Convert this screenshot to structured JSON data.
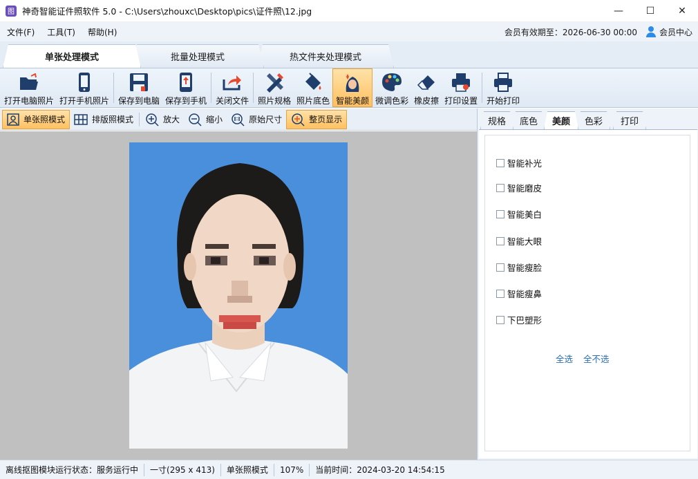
{
  "window": {
    "title": "神奇智能证件照软件 5.0 - C:\\Users\\zhouxc\\Desktop\\pics\\证件照\\12.jpg",
    "app_icon_glyph": "图",
    "minimize_glyph": "—",
    "maximize_glyph": "☐",
    "close_glyph": "✕"
  },
  "menu": {
    "file": "文件(F)",
    "tools": "工具(T)",
    "help": "帮助(H)",
    "member_validity": "会员有效期至：2026-06-30 00:00",
    "member_center": "会员中心"
  },
  "mode_tabs": [
    "单张处理模式",
    "批量处理模式",
    "热文件夹处理模式"
  ],
  "toolbar": {
    "items": [
      {
        "label": "打开电脑照片",
        "icon": "folder-open-icon"
      },
      {
        "label": "打开手机照片",
        "icon": "phone-icon"
      },
      {
        "label": "保存到电脑",
        "icon": "save-icon"
      },
      {
        "label": "保存到手机",
        "icon": "phone-upload-icon"
      },
      {
        "label": "关闭文件",
        "icon": "share-icon"
      },
      {
        "label": "照片规格",
        "icon": "pencil-ruler-icon"
      },
      {
        "label": "照片底色",
        "icon": "paint-bucket-icon"
      },
      {
        "label": "智能美颜",
        "icon": "beauty-face-icon"
      },
      {
        "label": "微调色彩",
        "icon": "palette-icon"
      },
      {
        "label": "橡皮擦",
        "icon": "eraser-icon"
      },
      {
        "label": "打印设置",
        "icon": "printer-settings-icon"
      },
      {
        "label": "开始打印",
        "icon": "printer-icon"
      }
    ],
    "active": "智能美颜"
  },
  "viewbar": {
    "single_mode": "单张照模式",
    "layout_mode": "排版照模式",
    "zoom_in": "放大",
    "zoom_out": "缩小",
    "original_size": "原始尺寸",
    "fit_page": "整页显示"
  },
  "panel": {
    "tabs": [
      "规格",
      "底色",
      "美颜",
      "色彩",
      "打印"
    ],
    "active_tab": "美颜",
    "options": [
      {
        "label": "智能补光",
        "checked": false
      },
      {
        "label": "智能磨皮",
        "checked": false
      },
      {
        "label": "智能美白",
        "checked": false
      },
      {
        "label": "智能大眼",
        "checked": false
      },
      {
        "label": "智能瘦脸",
        "checked": false
      },
      {
        "label": "智能瘦鼻",
        "checked": false
      },
      {
        "label": "下巴塑形",
        "checked": false
      }
    ],
    "select_all": "全选",
    "select_none": "全不选"
  },
  "status": {
    "service": "离线抠图模块运行状态：服务运行中",
    "spec": "一寸(295 x 413)",
    "mode": "单张照模式",
    "zoom": "107%",
    "time": "当前时间：2024-03-20 14:54:15"
  },
  "colors": {
    "photo_background": "#4a8fdc",
    "accent": "#ffc061",
    "link": "#2a6fb8"
  }
}
